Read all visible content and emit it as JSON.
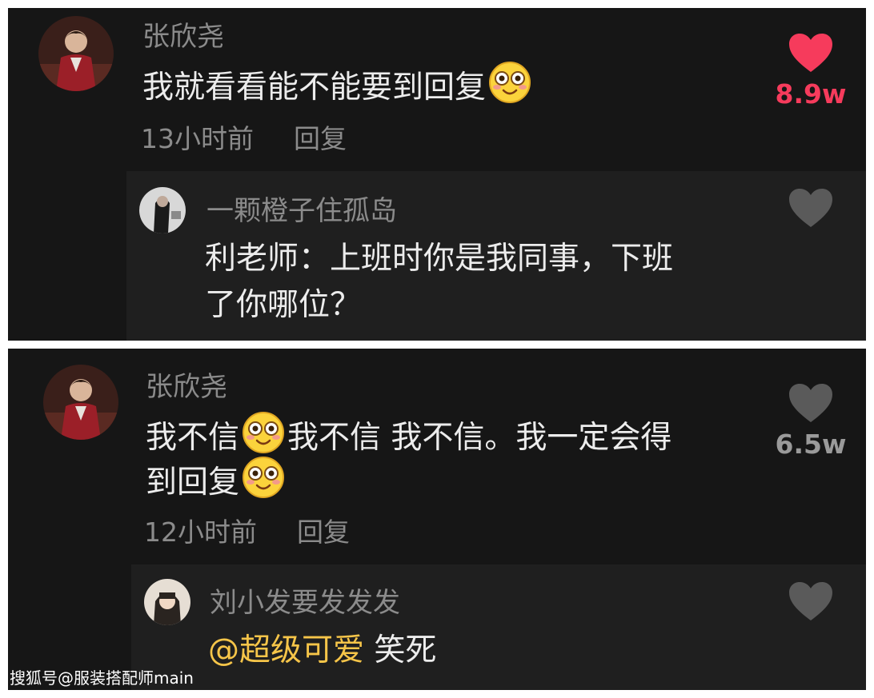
{
  "comment1": {
    "username": "张欣尧",
    "text_before_emoji": "我就看看能不能要到回复",
    "time": "13小时前",
    "reply_label": "回复",
    "like_count": "8.9w",
    "liked": true,
    "heart_icon": "heart-filled-icon",
    "like_color": "#f63b5c"
  },
  "reply1": {
    "username": "一颗橙子住孤岛",
    "text_line1": "利老师：上班时你是我同事，下班",
    "text_line2": "了你哪位？",
    "heart_icon": "heart-outline-icon"
  },
  "comment2": {
    "username": "张欣尧",
    "seg1": "我不信",
    "seg2": "我不信 我不信。我一定会得",
    "seg3": "到回复",
    "time": "12小时前",
    "reply_label": "回复",
    "like_count": "6.5w",
    "liked": false,
    "heart_icon": "heart-outline-icon"
  },
  "reply2": {
    "username": "刘小发要发发发",
    "mention": "@超级可爱",
    "text": " 笑死",
    "heart_icon": "heart-outline-icon"
  },
  "watermark": "搜狐号@服装搭配师main",
  "colors": {
    "background": "#161616",
    "reply_background": "#1f1f1f",
    "text": "#ececec",
    "muted": "#8b8b8b",
    "liked": "#f63b5c",
    "mention": "#f6c549"
  }
}
